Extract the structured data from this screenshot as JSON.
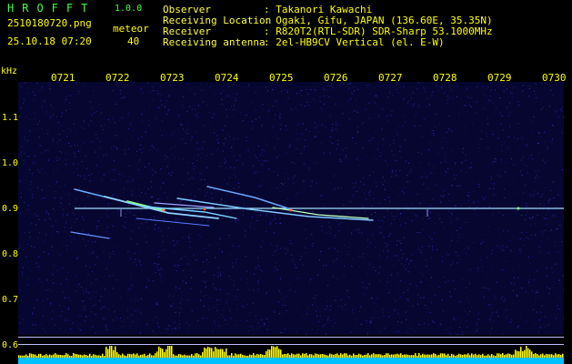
{
  "app": {
    "name": "HROFFT",
    "version": "1.0.0"
  },
  "file": {
    "name": "2510180720.png",
    "datetime": "25.10.18 07:20"
  },
  "count": {
    "label": "meteor",
    "value": "40"
  },
  "info": [
    {
      "label": "Observer",
      "value": ": Takanori Kawachi"
    },
    {
      "label": "Receiving Location",
      "value": ": Ogaki, Gifu, JAPAN (136.60E, 35.35N)"
    },
    {
      "label": "Receiver",
      "value": ": R820T2(RTL-SDR) SDR-Sharp 53.1000MHz"
    },
    {
      "label": "Receiving antenna",
      "value": ": 2el-HB9CV Vertical (el. E-W)"
    }
  ],
  "axis": {
    "unit": "kHz",
    "time_ticks": [
      "0721",
      "0722",
      "0723",
      "0724",
      "0725",
      "0726",
      "0727",
      "0728",
      "0729",
      "0730"
    ],
    "freq_ticks": [
      "1.1",
      "1.0",
      "0.9",
      "0.8",
      "0.7",
      "0.6"
    ]
  },
  "colors": {
    "text": "#ffff00",
    "header": "#40ff40",
    "background": "#060630",
    "carrier": "#a0e0ff",
    "strip_cyan": "#00c0ff",
    "strip_yellow": "#ffff00"
  }
}
